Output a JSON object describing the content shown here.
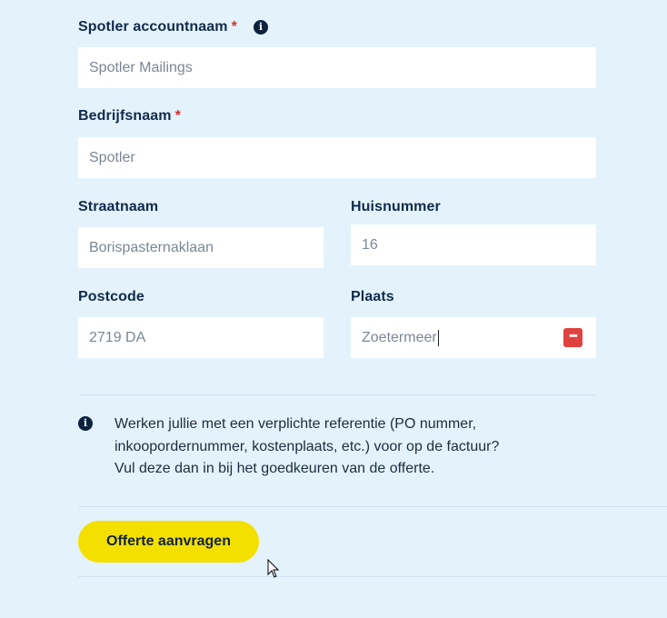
{
  "fields": {
    "account": {
      "label": "Spotler accountnaam",
      "required_mark": "*",
      "value": "Spotler Mailings"
    },
    "company": {
      "label": "Bedrijfsnaam",
      "required_mark": "*",
      "value": "Spotler"
    },
    "street": {
      "label": "Straatnaam",
      "value": "Borispasternaklaan"
    },
    "house_number": {
      "label": "Huisnummer",
      "value": "16"
    },
    "postcode": {
      "label": "Postcode",
      "value": "2719 DA"
    },
    "city": {
      "label": "Plaats",
      "value": "Zoetermeer"
    }
  },
  "icons": {
    "info": "info-icon",
    "password_manager": "password-manager-icon",
    "cursor": "mouse-pointer-icon"
  },
  "notice": {
    "line1": "Werken jullie met een verplichte referentie (PO nummer,",
    "line2": "inkoopordernummer, kostenplaats, etc.) voor op de factuur?",
    "line3": "Vul deze dan in bij het goedkeuren van de offerte."
  },
  "submit": {
    "label": "Offerte aanvragen"
  },
  "colors": {
    "background": "#e4f3fb",
    "required": "#d0312d",
    "cta": "#f4e000",
    "password_icon": "#e0423f"
  }
}
